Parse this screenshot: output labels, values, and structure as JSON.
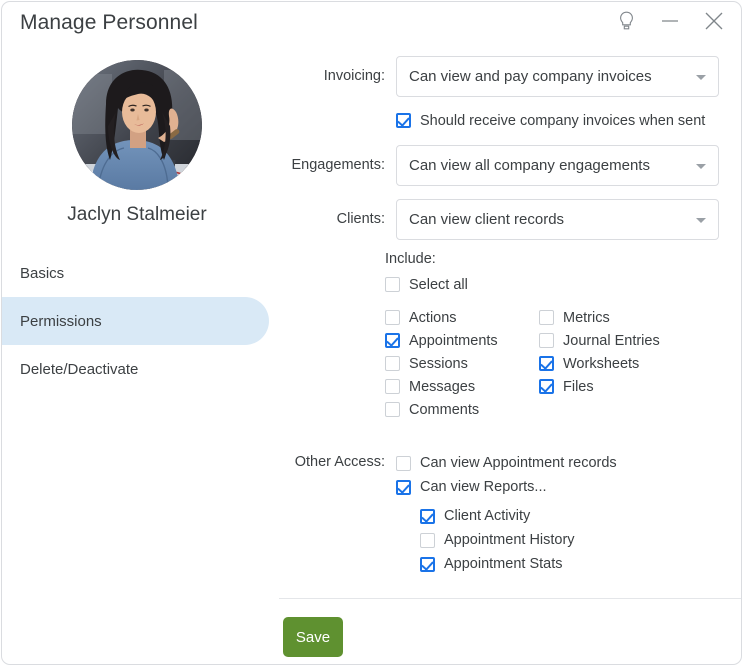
{
  "window": {
    "title": "Manage Personnel",
    "controls": [
      {
        "name": "hint-lightbulb",
        "label": "Tips"
      },
      {
        "name": "minimize",
        "label": "Minimize"
      },
      {
        "name": "close",
        "label": "Close"
      }
    ]
  },
  "sidebar": {
    "person_name": "Jaclyn Stalmeier",
    "avatar_alt": "Jaclyn Stalmeier profile photo",
    "items": [
      {
        "label": "Basics",
        "active": false
      },
      {
        "label": "Permissions",
        "active": true
      },
      {
        "label": "Delete/Deactivate",
        "active": false
      }
    ]
  },
  "main": {
    "invoicing": {
      "label": "Invoicing:",
      "value": "Can view and pay company invoices",
      "caret": "chevron-down-icon"
    },
    "invoice_checkbox": {
      "label": "Should receive company invoices when sent",
      "checked": true
    },
    "engagements": {
      "label": "Engagements:",
      "value": "Can view all company engagements",
      "caret": "chevron-down-icon"
    },
    "clients": {
      "label": "Clients:",
      "value": "Can view client records",
      "caret": "chevron-down-icon"
    },
    "include": {
      "title": "Include:",
      "select_all": {
        "label": "Select all",
        "checked": false
      },
      "left_column": [
        {
          "label": "Actions",
          "checked": false
        },
        {
          "label": "Appointments",
          "checked": true
        },
        {
          "label": "Sessions",
          "checked": false
        },
        {
          "label": "Messages",
          "checked": false
        },
        {
          "label": "Comments",
          "checked": false
        }
      ],
      "right_column": [
        {
          "label": "Metrics",
          "checked": false
        },
        {
          "label": "Journal Entries",
          "checked": false
        },
        {
          "label": "Worksheets",
          "checked": true
        },
        {
          "label": "Files",
          "checked": true
        }
      ]
    },
    "other_access": {
      "label": "Other Access:",
      "items": [
        {
          "label": "Can view Appointment records",
          "checked": false
        },
        {
          "label": "Can view Reports...",
          "checked": true
        }
      ],
      "report_subitems": [
        {
          "label": "Client Activity",
          "checked": true
        },
        {
          "label": "Appointment History",
          "checked": false
        },
        {
          "label": "Appointment Stats",
          "checked": true
        }
      ]
    }
  },
  "footer": {
    "save_label": "Save"
  },
  "colors": {
    "accent_blue": "#1a73e8",
    "active_nav_bg": "#d9e9f6",
    "save_green": "#5f9130",
    "text": "#3c4043",
    "border": "#dadce0"
  }
}
